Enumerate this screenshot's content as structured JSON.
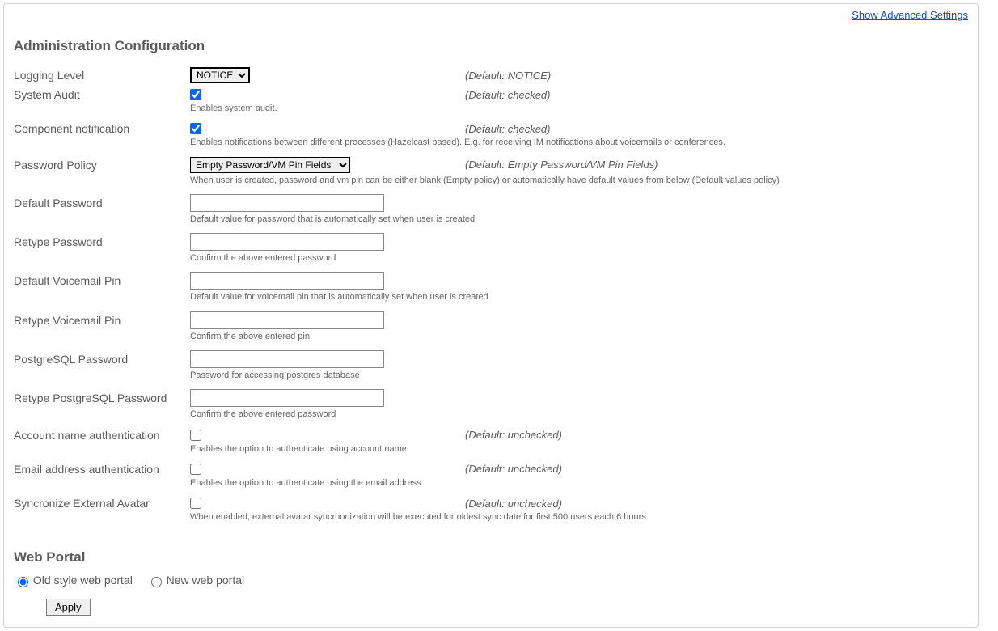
{
  "link": {
    "advanced": "Show Advanced Settings"
  },
  "section": {
    "admin": "Administration Configuration",
    "web": "Web Portal"
  },
  "fields": {
    "logging": {
      "label": "Logging Level",
      "default": "(Default: NOTICE)",
      "value": "NOTICE"
    },
    "audit": {
      "label": "System Audit",
      "default": "(Default: checked)",
      "desc": "Enables system audit."
    },
    "component": {
      "label": "Component notification",
      "default": "(Default: checked)",
      "desc": "Enables notifications between different processes (Hazelcast based). E.g. for receiving IM notifications about voicemails or conferences."
    },
    "policy": {
      "label": "Password Policy",
      "default": "(Default: Empty Password/VM Pin Fields)",
      "value": "Empty Password/VM Pin Fields",
      "desc": "When user is created, password and vm pin can be either blank (Empty policy) or automatically have default values from below (Default values policy)"
    },
    "defpass": {
      "label": "Default Password",
      "desc": "Default value for password that is automatically set when user is created"
    },
    "repass": {
      "label": "Retype Password",
      "desc": "Confirm the above entered password"
    },
    "defpin": {
      "label": "Default Voicemail Pin",
      "desc": "Default value for voicemail pin that is automatically set when user is created"
    },
    "repin": {
      "label": "Retype Voicemail Pin",
      "desc": "Confirm the above entered pin"
    },
    "pgpass": {
      "label": "PostgreSQL Password",
      "desc": "Password for accessing postgres database"
    },
    "repgpass": {
      "label": "Retype PostgreSQL Password",
      "desc": "Confirm the above entered password"
    },
    "acctauth": {
      "label": "Account name authentication",
      "default": "(Default: unchecked)",
      "desc": "Enables the option to authenticate using account name"
    },
    "emailauth": {
      "label": "Email address authentication",
      "default": "(Default: unchecked)",
      "desc": "Enables the option to authenticate using the email address"
    },
    "syncavatar": {
      "label": "Syncronize External Avatar",
      "default": "(Default: unchecked)",
      "desc": "When enabled, external avatar syncrhonization will be executed for oldest sync date for first 500 users each 6 hours"
    }
  },
  "portal": {
    "old": "Old style web portal",
    "new": "New web portal"
  },
  "buttons": {
    "apply": "Apply"
  }
}
